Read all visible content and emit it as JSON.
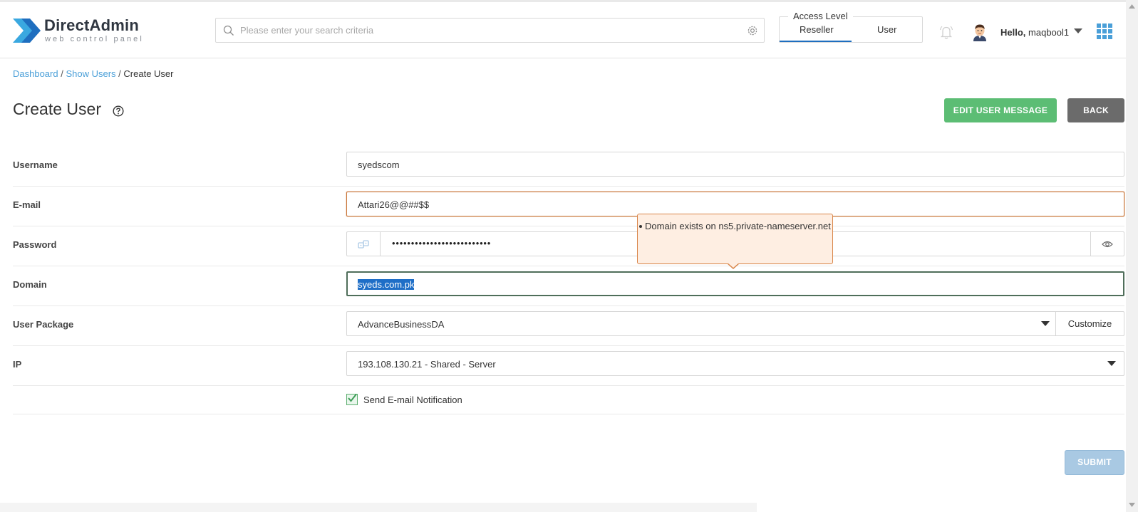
{
  "brand": {
    "title": "DirectAdmin",
    "subtitle": "web control panel",
    "colors": {
      "primary": "#1e6ebf",
      "mark_light": "#3aa8e0"
    }
  },
  "header": {
    "search": {
      "placeholder": "Please enter your search criteria",
      "value": ""
    },
    "access_level": {
      "title": "Access Level",
      "tabs": [
        "Reseller",
        "User"
      ],
      "active": "Reseller"
    },
    "greeting": {
      "prefix": "Hello,",
      "username": "maqbool1"
    },
    "icons": [
      "search-icon",
      "gear-icon",
      "bell-icon",
      "avatar",
      "chevron-down-icon",
      "apps-grid-icon"
    ]
  },
  "breadcrumb": [
    {
      "label": "Dashboard"
    },
    {
      "label": "Show Users"
    },
    {
      "label": "Create User"
    }
  ],
  "page": {
    "title": "Create User",
    "buttons": {
      "edit_user_message": "EDIT USER MESSAGE",
      "back": "BACK",
      "submit": "SUBMIT"
    }
  },
  "form": {
    "username": {
      "label": "Username",
      "value": "syedscom"
    },
    "email": {
      "label": "E-mail",
      "value": "Attari26@@##$$",
      "state": "error"
    },
    "password": {
      "label": "Password",
      "value": "••••••••••••••••••••••••••"
    },
    "domain": {
      "label": "Domain",
      "value": "syeds.com.pk",
      "state": "focused-selected"
    },
    "package": {
      "label": "User Package",
      "value": "AdvanceBusinessDA",
      "customize": "Customize"
    },
    "ip": {
      "label": "IP",
      "value": "193.108.130.21 - Shared - Server"
    },
    "notify": {
      "label": "Send E-mail Notification",
      "checked": true
    }
  },
  "tooltip": {
    "messages": [
      "Domain exists on ns5.private-nameserver.net"
    ]
  },
  "colors": {
    "link": "#4a9fd8",
    "edit_button": "#5cbd74",
    "back_button": "#6b6b6b",
    "submit_disabled": "#a9c9e3",
    "error_border": "#c9763a",
    "tooltip_bg": "#feeee2"
  }
}
